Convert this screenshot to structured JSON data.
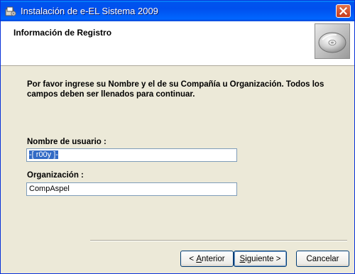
{
  "window": {
    "title": "Instalación de e-EL Sistema 2009"
  },
  "banner": {
    "title": "Información de Registro"
  },
  "intro": "Por favor ingrese su Nombre y el de su Compañía u Organización. Todos los campos deben ser llenados para continuar.",
  "form": {
    "username_label": "Nombre de usuario :",
    "username_value": "-[ r00y ]-",
    "organization_label": "Organización :",
    "organization_value": "CompAspel"
  },
  "buttons": {
    "back_mnemonic": "A",
    "back_rest": "nterior",
    "back_prefix": "< ",
    "next_mnemonic": "S",
    "next_rest": "iguiente",
    "next_suffix": " >",
    "cancel": "Cancelar"
  },
  "colors": {
    "titlebar": "#0054e3",
    "face": "#ece9d8",
    "selection": "#316ac5"
  },
  "icons": {
    "title": "installer-icon",
    "banner": "cd-disc-icon",
    "close": "close-icon"
  }
}
